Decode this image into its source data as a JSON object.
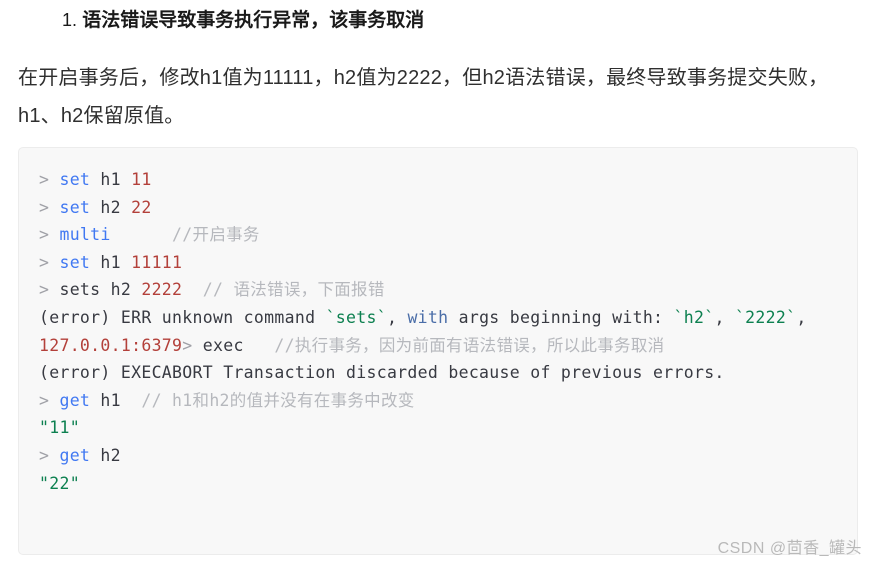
{
  "heading": {
    "number": "1.",
    "text": "语法错误导致事务执行异常，该事务取消"
  },
  "paragraph": {
    "text": "在开启事务后，修改h1值为11111，h2值为2222，但h2语法错误，最终导致事务提交失败，h1、h2保留原值。"
  },
  "code_block": {
    "language": "redis-cli",
    "lines": [
      {
        "id": "line-1",
        "tokens": [
          {
            "t": "prompt",
            "v": "> "
          },
          {
            "t": "cmd",
            "v": "set"
          },
          {
            "t": "plain",
            "v": " "
          },
          {
            "t": "key",
            "v": "h1"
          },
          {
            "t": "plain",
            "v": " "
          },
          {
            "t": "num",
            "v": "11"
          }
        ]
      },
      {
        "id": "line-2",
        "tokens": [
          {
            "t": "prompt",
            "v": "> "
          },
          {
            "t": "cmd",
            "v": "set"
          },
          {
            "t": "plain",
            "v": " "
          },
          {
            "t": "key",
            "v": "h2"
          },
          {
            "t": "plain",
            "v": " "
          },
          {
            "t": "num",
            "v": "22"
          }
        ]
      },
      {
        "id": "line-3",
        "tokens": [
          {
            "t": "prompt",
            "v": "> "
          },
          {
            "t": "cmd",
            "v": "multi"
          },
          {
            "t": "plain",
            "v": "      "
          },
          {
            "t": "comment",
            "v": "//开启事务"
          }
        ]
      },
      {
        "id": "line-4",
        "tokens": [
          {
            "t": "prompt",
            "v": "> "
          },
          {
            "t": "cmd",
            "v": "set"
          },
          {
            "t": "plain",
            "v": " "
          },
          {
            "t": "key",
            "v": "h1"
          },
          {
            "t": "plain",
            "v": " "
          },
          {
            "t": "num",
            "v": "11111"
          }
        ]
      },
      {
        "id": "line-5",
        "tokens": [
          {
            "t": "prompt",
            "v": "> "
          },
          {
            "t": "plain",
            "v": "sets "
          },
          {
            "t": "key",
            "v": "h2"
          },
          {
            "t": "plain",
            "v": " "
          },
          {
            "t": "num",
            "v": "2222"
          },
          {
            "t": "plain",
            "v": "  "
          },
          {
            "t": "comment",
            "v": "// 语法错误，下面报错"
          }
        ]
      },
      {
        "id": "line-6",
        "tokens": [
          {
            "t": "plain",
            "v": "(error) ERR unknown command "
          },
          {
            "t": "str",
            "v": "`sets`"
          },
          {
            "t": "plain",
            "v": ", "
          },
          {
            "t": "with",
            "v": "with"
          },
          {
            "t": "plain",
            "v": " args beginning with: "
          },
          {
            "t": "str",
            "v": "`h2`"
          },
          {
            "t": "plain",
            "v": ", "
          },
          {
            "t": "str",
            "v": "`2222`"
          },
          {
            "t": "plain",
            "v": ","
          }
        ]
      },
      {
        "id": "line-7",
        "tokens": [
          {
            "t": "host",
            "v": "127.0.0.1:6379"
          },
          {
            "t": "prompt",
            "v": "> "
          },
          {
            "t": "plain",
            "v": "exec"
          },
          {
            "t": "plain",
            "v": "   "
          },
          {
            "t": "comment",
            "v": "//执行事务，因为前面有语法错误，所以此事务取消"
          }
        ]
      },
      {
        "id": "line-8",
        "tokens": [
          {
            "t": "plain",
            "v": "(error) EXECABORT Transaction discarded because of previous errors."
          }
        ]
      },
      {
        "id": "line-9",
        "tokens": [
          {
            "t": "prompt",
            "v": "> "
          },
          {
            "t": "cmd",
            "v": "get"
          },
          {
            "t": "plain",
            "v": " "
          },
          {
            "t": "key",
            "v": "h1"
          },
          {
            "t": "plain",
            "v": "  "
          },
          {
            "t": "comment",
            "v": "// h1和h2的值并没有在事务中改变"
          }
        ]
      },
      {
        "id": "line-10",
        "tokens": [
          {
            "t": "str",
            "v": "\"11\""
          }
        ]
      },
      {
        "id": "line-11",
        "tokens": [
          {
            "t": "prompt",
            "v": "> "
          },
          {
            "t": "cmd",
            "v": "get"
          },
          {
            "t": "plain",
            "v": " "
          },
          {
            "t": "key",
            "v": "h2"
          }
        ]
      },
      {
        "id": "line-12",
        "tokens": [
          {
            "t": "str",
            "v": "\"22\""
          }
        ]
      }
    ]
  },
  "watermark": {
    "text": "CSDN @茴香_罐头"
  },
  "colors": {
    "command": "#4078f2",
    "number": "#b3403a",
    "string": "#0d8050",
    "comment": "#b6b8bd",
    "prompt": "#a0a1a7",
    "plain": "#383a42",
    "code_bg": "#f8f8f8",
    "code_border": "#ececec",
    "watermark": "#b9b9b9"
  }
}
